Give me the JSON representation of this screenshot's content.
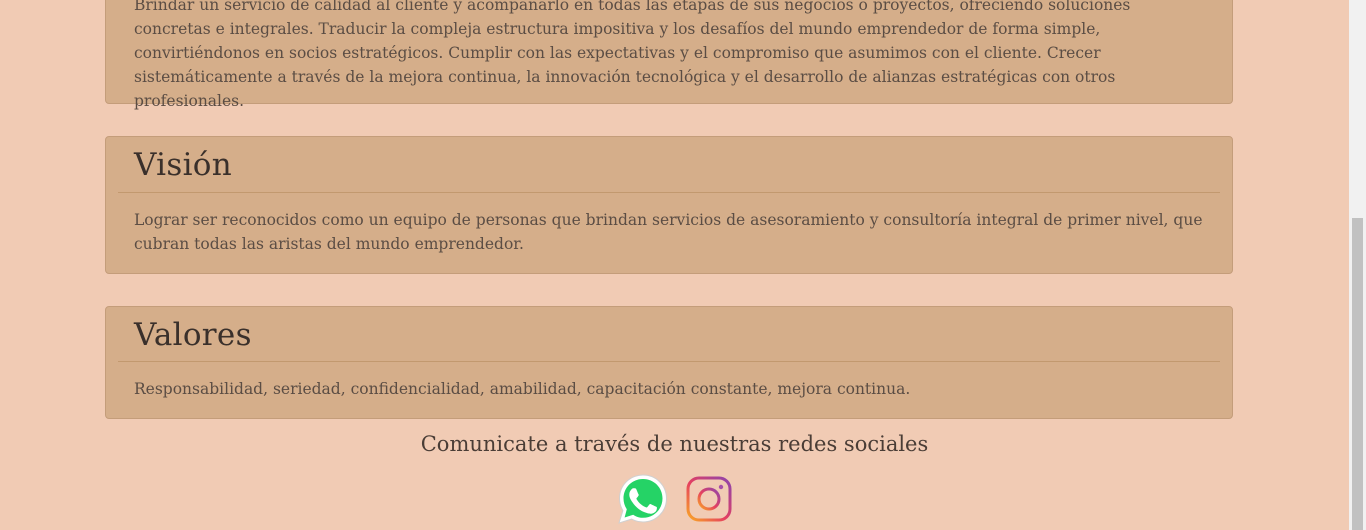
{
  "mision": {
    "text": "Brindar un servicio de calidad al cliente y acompañarlo en todas las etapas de sus negocios o proyectos, ofreciendo soluciones concretas e integrales. Traducir la compleja estructura impositiva y los desafíos del mundo emprendedor de forma simple, convirtiéndonos en socios estratégicos. Cumplir con las expectativas y el compromiso que asumimos con el cliente. Crecer sistemáticamente a través de la mejora continua, la innovación tecnológica y el desarrollo de alianzas estratégicas con otros profesionales."
  },
  "vision": {
    "title": "Visión",
    "text": "Lograr ser reconocidos como un equipo de personas que brindan servicios de asesoramiento y consultoría integral de primer nivel, que cubran todas las aristas del mundo emprendedor."
  },
  "valores": {
    "title": "Valores",
    "text": "Responsabilidad, seriedad, confidencialidad, amabilidad, capacitación constante, mejora continua."
  },
  "social": {
    "title": "Comunicate a través de nuestras redes sociales",
    "icons": [
      "whatsapp-icon",
      "instagram-icon"
    ]
  },
  "colors": {
    "background": "#f1cbb4",
    "card": "#d5ae8a",
    "whatsapp": "#25d366"
  }
}
